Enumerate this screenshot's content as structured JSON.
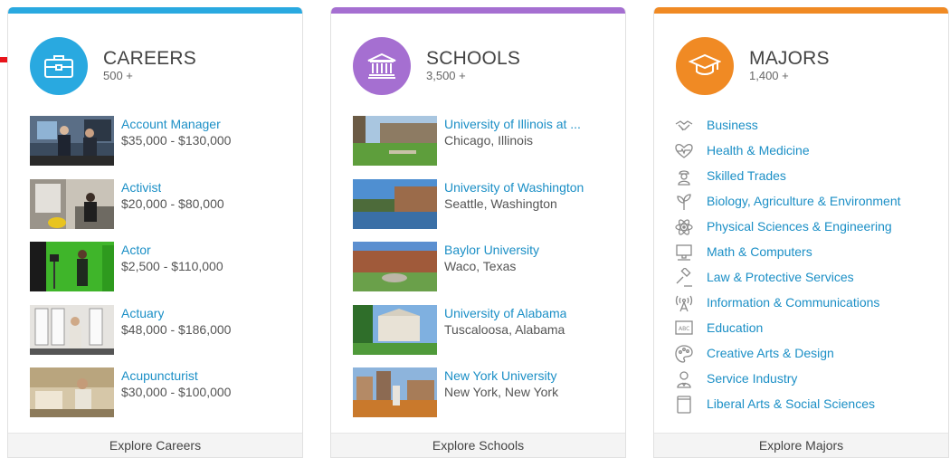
{
  "careers": {
    "title": "CAREERS",
    "count": "500 +",
    "accent": "#29a9e0",
    "icon": "briefcase-icon",
    "items": [
      {
        "title": "Account Manager",
        "sub": "$35,000 - $130,000"
      },
      {
        "title": "Activist",
        "sub": "$20,000 - $80,000"
      },
      {
        "title": "Actor",
        "sub": "$2,500 - $110,000"
      },
      {
        "title": "Actuary",
        "sub": "$48,000 - $186,000"
      },
      {
        "title": "Acupuncturist",
        "sub": "$30,000 - $100,000"
      }
    ],
    "footer": "Explore Careers"
  },
  "schools": {
    "title": "SCHOOLS",
    "count": "3,500 +",
    "accent": "#a56fd1",
    "icon": "university-building-icon",
    "items": [
      {
        "title": "University of Illinois at ...",
        "sub": "Chicago, Illinois"
      },
      {
        "title": "University of Washington",
        "sub": "Seattle, Washington"
      },
      {
        "title": "Baylor University",
        "sub": "Waco, Texas"
      },
      {
        "title": "University of Alabama",
        "sub": "Tuscaloosa, Alabama"
      },
      {
        "title": "New York University",
        "sub": "New York, New York"
      }
    ],
    "footer": "Explore Schools"
  },
  "majors": {
    "title": "MAJORS",
    "count": "1,400 +",
    "accent": "#f08a24",
    "icon": "graduation-cap-icon",
    "items": [
      {
        "label": "Business",
        "icon": "handshake-icon"
      },
      {
        "label": "Health & Medicine",
        "icon": "heartbeat-icon"
      },
      {
        "label": "Skilled Trades",
        "icon": "worker-icon"
      },
      {
        "label": "Biology, Agriculture & Environment",
        "icon": "plant-icon"
      },
      {
        "label": "Physical Sciences & Engineering",
        "icon": "atom-icon"
      },
      {
        "label": "Math & Computers",
        "icon": "computer-icon"
      },
      {
        "label": "Law & Protective Services",
        "icon": "gavel-icon"
      },
      {
        "label": "Information & Communications",
        "icon": "antenna-icon"
      },
      {
        "label": "Education",
        "icon": "chalkboard-icon"
      },
      {
        "label": "Creative Arts & Design",
        "icon": "palette-icon"
      },
      {
        "label": "Service Industry",
        "icon": "service-person-icon"
      },
      {
        "label": "Liberal Arts & Social Sciences",
        "icon": "book-icon"
      }
    ],
    "footer": "Explore Majors"
  },
  "annotation_arrow_color": "#e8141b"
}
